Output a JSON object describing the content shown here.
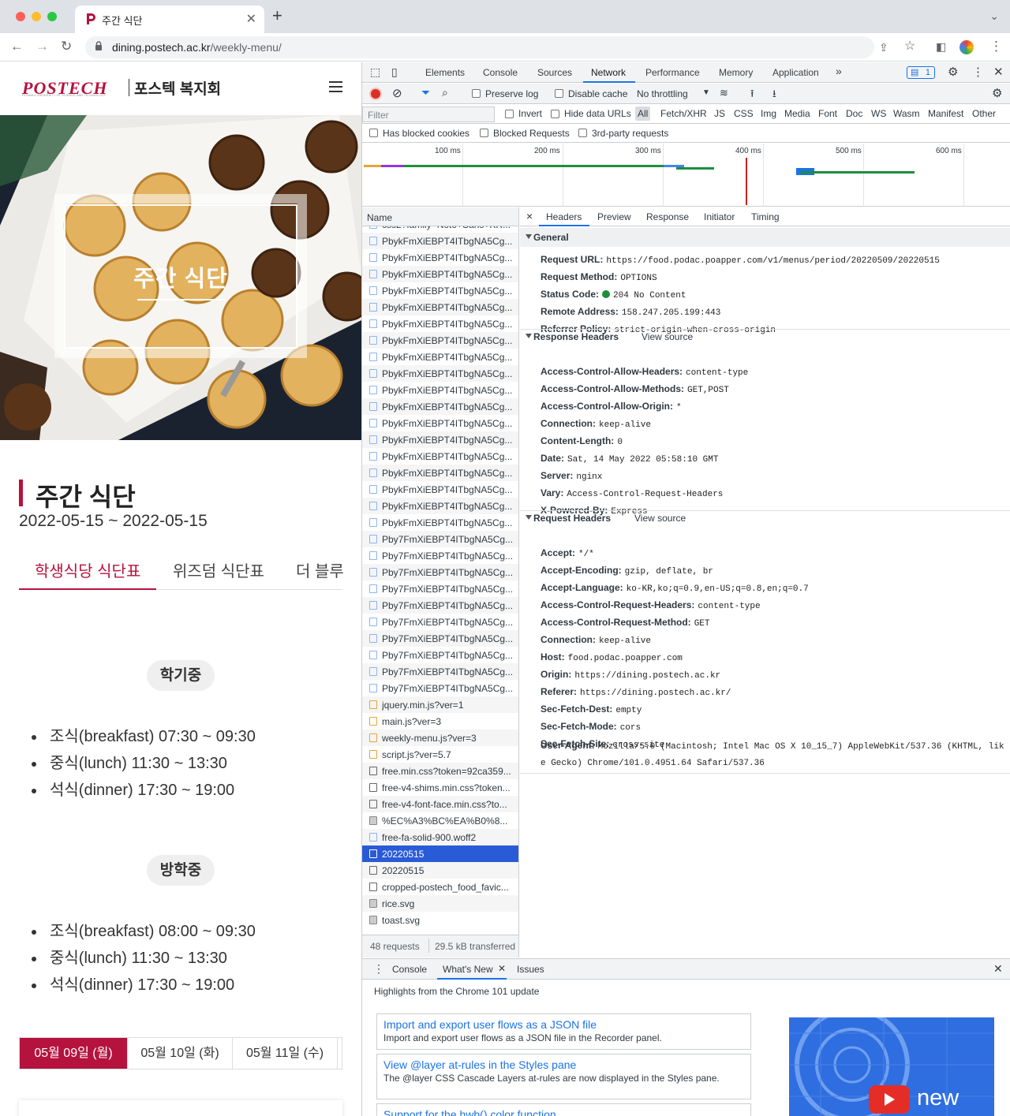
{
  "browser": {
    "tab_title": "주간 식단",
    "url_domain": "dining.postech.ac.kr",
    "url_path": "/weekly-menu/"
  },
  "site": {
    "logo_text": "POSTECH",
    "logo_subtext": "POHANG UNIVERSITY OF SCIENCE AND TECHNOLOGY",
    "logo_name": "포스텍 복지회",
    "hero_title": "주간 식단",
    "section_title": "주간 식단",
    "date_range": "2022-05-15 ~ 2022-05-15",
    "restaurant_tabs": [
      "학생식당 식단표",
      "위즈덤 식단표",
      "더 블루"
    ],
    "semester_label": "학기중",
    "semester_meals": [
      "조식(breakfast) 07:30 ~ 09:30",
      "중식(lunch) 11:30 ~ 13:30",
      "석식(dinner) 17:30 ~ 19:00"
    ],
    "vacation_label": "방학중",
    "vacation_meals": [
      "조식(breakfast) 08:00 ~ 09:30",
      "중식(lunch) 11:30 ~ 13:30",
      "석식(dinner) 17:30 ~ 19:00"
    ],
    "days": [
      "05월 09일 (월)",
      "05월 10일 (화)",
      "05월 11일 (수)"
    ]
  },
  "devtools": {
    "tabs": [
      "Elements",
      "Console",
      "Sources",
      "Network",
      "Performance",
      "Memory",
      "Application"
    ],
    "more": "»",
    "issues_badge": "1",
    "toolbar": {
      "preserve_log": "Preserve log",
      "disable_cache": "Disable cache",
      "throttling": "No throttling"
    },
    "filter_placeholder": "Filter",
    "invert": "Invert",
    "hide_data_urls": "Hide data URLs",
    "types": [
      "All",
      "Fetch/XHR",
      "JS",
      "CSS",
      "Img",
      "Media",
      "Font",
      "Doc",
      "WS",
      "Wasm",
      "Manifest",
      "Other"
    ],
    "blocked": [
      "Has blocked cookies",
      "Blocked Requests",
      "3rd-party requests"
    ],
    "timeline_ticks": [
      "100 ms",
      "200 ms",
      "300 ms",
      "400 ms",
      "500 ms",
      "600 ms"
    ],
    "name_header": "Name",
    "requests": [
      "css2?family=Noto+Sans+KR...",
      "PbykFmXiEBPT4ITbgNA5Cg...",
      "PbykFmXiEBPT4ITbgNA5Cg...",
      "PbykFmXiEBPT4ITbgNA5Cg...",
      "PbykFmXiEBPT4ITbgNA5Cg...",
      "PbykFmXiEBPT4ITbgNA5Cg...",
      "PbykFmXiEBPT4ITbgNA5Cg...",
      "PbykFmXiEBPT4ITbgNA5Cg...",
      "PbykFmXiEBPT4ITbgNA5Cg...",
      "PbykFmXiEBPT4ITbgNA5Cg...",
      "PbykFmXiEBPT4ITbgNA5Cg...",
      "PbykFmXiEBPT4ITbgNA5Cg...",
      "PbykFmXiEBPT4ITbgNA5Cg...",
      "PbykFmXiEBPT4ITbgNA5Cg...",
      "PbykFmXiEBPT4ITbgNA5Cg...",
      "PbykFmXiEBPT4ITbgNA5Cg...",
      "PbykFmXiEBPT4ITbgNA5Cg...",
      "PbykFmXiEBPT4ITbgNA5Cg...",
      "PbykFmXiEBPT4ITbgNA5Cg...",
      "Pby7FmXiEBPT4ITbgNA5Cg...",
      "Pby7FmXiEBPT4ITbgNA5Cg...",
      "Pby7FmXiEBPT4ITbgNA5Cg...",
      "Pby7FmXiEBPT4ITbgNA5Cg...",
      "Pby7FmXiEBPT4ITbgNA5Cg...",
      "Pby7FmXiEBPT4ITbgNA5Cg...",
      "Pby7FmXiEBPT4ITbgNA5Cg...",
      "Pby7FmXiEBPT4ITbgNA5Cg...",
      "Pby7FmXiEBPT4ITbgNA5Cg...",
      "Pby7FmXiEBPT4ITbgNA5Cg...",
      "jquery.min.js?ver=1",
      "main.js?ver=3",
      "weekly-menu.js?ver=3",
      "script.js?ver=5.7",
      "free.min.css?token=92ca359...",
      "free-v4-shims.min.css?token...",
      "free-v4-font-face.min.css?to...",
      "%EC%A3%BC%EA%B0%8...",
      "free-fa-solid-900.woff2",
      "20220515",
      "20220515",
      "cropped-postech_food_favic...",
      "rice.svg",
      "toast.svg"
    ],
    "summary_requests": "48 requests",
    "summary_transferred": "29.5 kB transferred",
    "detail_tabs": [
      "Headers",
      "Preview",
      "Response",
      "Initiator",
      "Timing"
    ],
    "general_title": "General",
    "general": [
      {
        "k": "Request URL:",
        "v": "https://food.podac.poapper.com/v1/menus/period/20220509/20220515"
      },
      {
        "k": "Request Method:",
        "v": "OPTIONS"
      },
      {
        "k": "Status Code:",
        "v": "204 No Content"
      },
      {
        "k": "Remote Address:",
        "v": "158.247.205.199:443"
      },
      {
        "k": "Referrer Policy:",
        "v": "strict-origin-when-cross-origin"
      }
    ],
    "response_title": "Response Headers",
    "view_source": "View source",
    "response_headers": [
      {
        "k": "Access-Control-Allow-Headers:",
        "v": "content-type"
      },
      {
        "k": "Access-Control-Allow-Methods:",
        "v": "GET,POST"
      },
      {
        "k": "Access-Control-Allow-Origin:",
        "v": "*"
      },
      {
        "k": "Connection:",
        "v": "keep-alive"
      },
      {
        "k": "Content-Length:",
        "v": "0"
      },
      {
        "k": "Date:",
        "v": "Sat, 14 May 2022 05:58:10 GMT"
      },
      {
        "k": "Server:",
        "v": "nginx"
      },
      {
        "k": "Vary:",
        "v": "Access-Control-Request-Headers"
      },
      {
        "k": "X-Powered-By:",
        "v": "Express"
      }
    ],
    "request_title": "Request Headers",
    "request_headers": [
      {
        "k": "Accept:",
        "v": "*/*"
      },
      {
        "k": "Accept-Encoding:",
        "v": "gzip, deflate, br"
      },
      {
        "k": "Accept-Language:",
        "v": "ko-KR,ko;q=0.9,en-US;q=0.8,en;q=0.7"
      },
      {
        "k": "Access-Control-Request-Headers:",
        "v": "content-type"
      },
      {
        "k": "Access-Control-Request-Method:",
        "v": "GET"
      },
      {
        "k": "Connection:",
        "v": "keep-alive"
      },
      {
        "k": "Host:",
        "v": "food.podac.poapper.com"
      },
      {
        "k": "Origin:",
        "v": "https://dining.postech.ac.kr"
      },
      {
        "k": "Referer:",
        "v": "https://dining.postech.ac.kr/"
      },
      {
        "k": "Sec-Fetch-Dest:",
        "v": "empty"
      },
      {
        "k": "Sec-Fetch-Mode:",
        "v": "cors"
      },
      {
        "k": "Sec-Fetch-Site:",
        "v": "cross-site"
      }
    ],
    "user_agent_key": "User-Agent:",
    "user_agent_line1": "Mozilla/5.0 (Macintosh; Intel Mac OS X 10_15_7) AppleWebKit/537.36 (KHTML, lik",
    "user_agent_line2": "e Gecko) Chrome/101.0.4951.64 Safari/537.36",
    "drawer_tabs": [
      "Console",
      "What's New",
      "Issues"
    ],
    "whats_new_heading": "Highlights from the Chrome 101 update",
    "cards": [
      {
        "title": "Import and export user flows as a JSON file",
        "desc": "Import and export user flows as a JSON file in the Recorder panel."
      },
      {
        "title": "View @layer at-rules in the Styles pane",
        "desc": "The @layer CSS Cascade Layers at-rules are now displayed in the Styles pane."
      },
      {
        "title": "Support for the hwb() color function",
        "desc": ""
      }
    ],
    "promo_text": "new"
  }
}
